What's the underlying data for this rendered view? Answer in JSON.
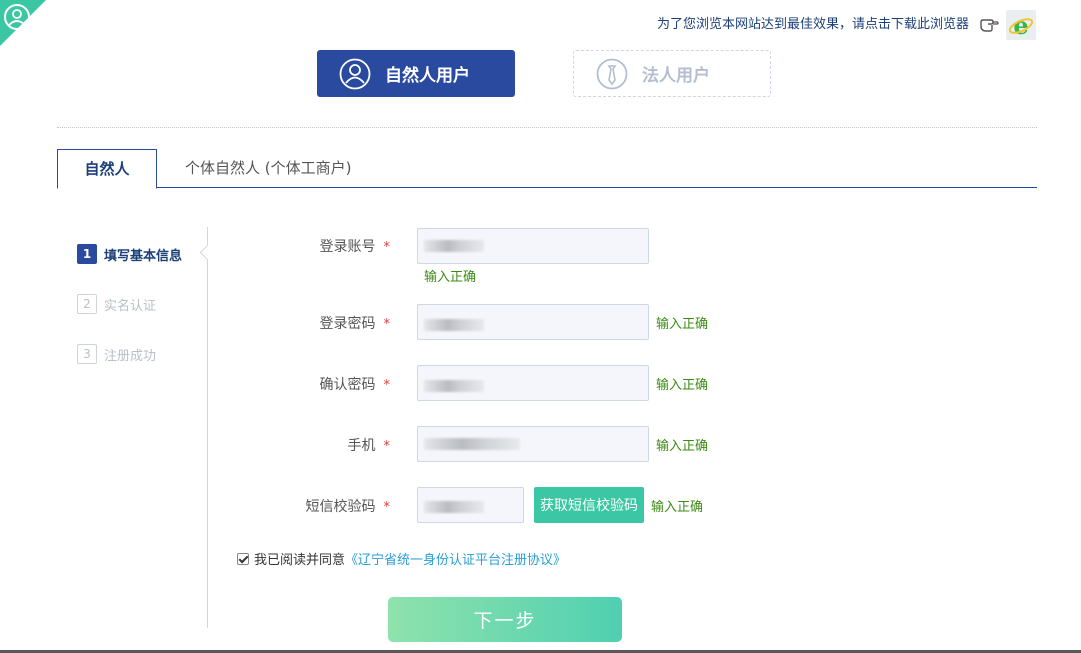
{
  "header": {
    "tip": "为了您浏览本网站达到最佳效果，请点击下载此浏览器",
    "hand_icon": "pointing-hand-icon",
    "browser_icon": "ie-browser-icon"
  },
  "user_types": [
    {
      "label": "自然人用户",
      "icon": "person-icon",
      "active": true
    },
    {
      "label": "法人用户",
      "icon": "necktie-icon",
      "active": false
    }
  ],
  "tabs": [
    {
      "label": "自然人",
      "active": true
    },
    {
      "label": "个体自然人 (个体工商户)",
      "active": false
    }
  ],
  "steps": [
    {
      "num": "1",
      "label": "填写基本信息",
      "active": true
    },
    {
      "num": "2",
      "label": "实名认证",
      "active": false
    },
    {
      "num": "3",
      "label": "注册成功",
      "active": false
    }
  ],
  "form": {
    "account_label": "登录账号",
    "password_label": "登录密码",
    "confirm_label": "确认密码",
    "phone_label": "手机",
    "sms_label": "短信校验码",
    "required_mark": "*",
    "valid_text": "输入正确",
    "sms_button": "获取短信校验码"
  },
  "agreement": {
    "checked": true,
    "prefix": "我已阅读并同意",
    "link": "《辽宁省统一身份认证平台注册协议》"
  },
  "next_button": "下一步",
  "colors": {
    "primary": "#2a4aa0",
    "accent": "#3cc7a4",
    "success": "#3b8a14",
    "required": "#e53935",
    "link": "#2a9fd6"
  }
}
